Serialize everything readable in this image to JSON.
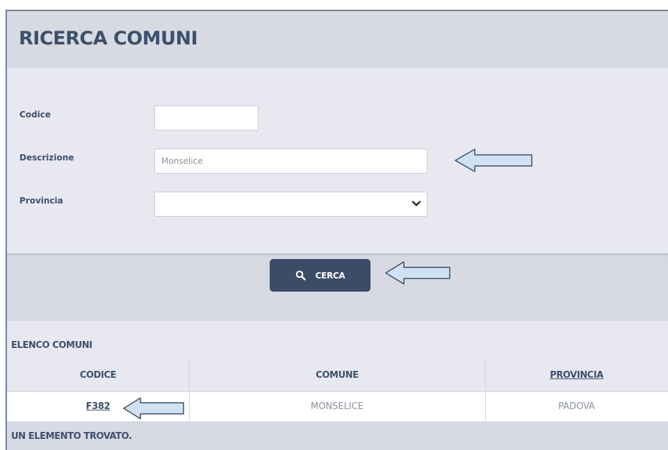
{
  "page": {
    "title": "RICERCA COMUNI"
  },
  "form": {
    "codice": {
      "label": "Codice",
      "value": ""
    },
    "descrizione": {
      "label": "Descrizione",
      "value": "Monselice"
    },
    "provincia": {
      "label": "Provincia",
      "value": ""
    }
  },
  "actions": {
    "search_label": "CERCA"
  },
  "results": {
    "title": "ELENCO COMUNI",
    "columns": [
      "CODICE",
      "COMUNE",
      "PROVINCIA"
    ],
    "rows": [
      {
        "codice": "F382",
        "comune": "MONSELICE",
        "provincia": "PADOVA"
      }
    ],
    "summary": "UN ELEMENTO TROVATO."
  },
  "colors": {
    "accent": "#3b4d66",
    "panel": "#e7e8f0",
    "header_band": "#d7dae3",
    "callout_fill": "#cfe2f3",
    "callout_stroke": "#3b4d66"
  },
  "icons": {
    "search": "search-icon",
    "select_chevron": "chevron-down-icon",
    "annotation": "arrow-left-icon"
  }
}
